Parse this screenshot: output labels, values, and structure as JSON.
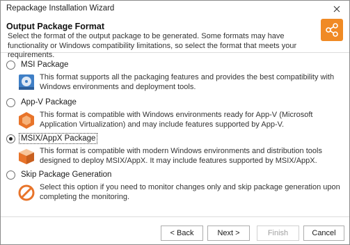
{
  "window": {
    "title": "Repackage Installation Wizard"
  },
  "header": {
    "title": "Output Package Format",
    "description": "Select the format of the output package to be generated. Some formats may have functionality or Windows compatibility limitations, so select the format that meets your requirements.",
    "icon": "share-icon",
    "icon_color": "#f08a24"
  },
  "options": [
    {
      "label": "MSI Package",
      "checked": false,
      "icon": "msi-disc-icon",
      "description": "This format supports all the packaging features and provides the best compatibility with Windows environments and deployment tools."
    },
    {
      "label": "App-V Package",
      "checked": false,
      "icon": "appv-hexagon-icon",
      "description": "This format is compatible with Windows environments ready for App-V (Microsoft Application Virtualization) and may include features supported by App-V."
    },
    {
      "label": "MSIX/AppX Package",
      "checked": true,
      "icon": "msix-package-icon",
      "description": "This format is compatible with modern Windows environments and distribution tools designed to deploy MSIX/AppX. It may include features supported by MSIX/AppX."
    },
    {
      "label": "Skip Package Generation",
      "checked": false,
      "icon": "skip-prohibited-icon",
      "description": "Select this option if you need to monitor changes only and skip package generation upon completing the monitoring."
    }
  ],
  "footer": {
    "back_label": "< Back",
    "next_label": "Next >",
    "finish_label": "Finish",
    "cancel_label": "Cancel"
  }
}
